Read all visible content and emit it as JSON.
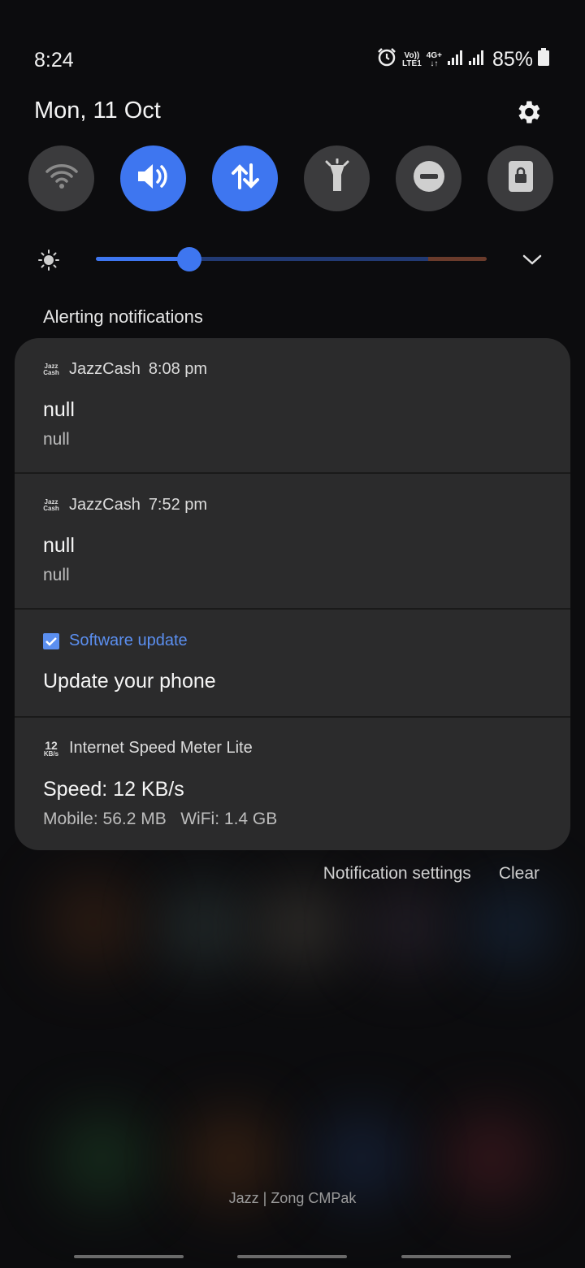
{
  "status_bar": {
    "time": "8:24",
    "volte_top": "Vo))",
    "volte_bottom": "LTE1",
    "net_top": "4G+",
    "net_bottom": "↓↑",
    "battery_percent": "85%",
    "icons": [
      "alarm-icon",
      "volte-icon",
      "4g-plus-icon",
      "signal-sim1-icon",
      "signal-sim2-icon",
      "battery-icon"
    ]
  },
  "header": {
    "date": "Mon, 11 Oct",
    "settings_icon": "gear-icon"
  },
  "quick_settings": [
    {
      "name": "wifi",
      "icon": "wifi-icon",
      "on": false
    },
    {
      "name": "sound",
      "icon": "volume-icon",
      "on": true
    },
    {
      "name": "mobile-data",
      "icon": "data-arrows-icon",
      "on": true
    },
    {
      "name": "flashlight",
      "icon": "flashlight-icon",
      "on": false
    },
    {
      "name": "do-not-disturb",
      "icon": "dnd-icon",
      "on": false
    },
    {
      "name": "portrait-lock",
      "icon": "rotation-lock-icon",
      "on": false
    }
  ],
  "brightness": {
    "level": 0.24,
    "icon": "sun-icon",
    "expand_icon": "chevron-down-icon"
  },
  "section_label": "Alerting notifications",
  "notifications": [
    {
      "app_icon_text_top": "Jazz",
      "app_icon_text_bottom": "Cash",
      "app": "JazzCash",
      "time": "8:08 pm",
      "title": "null",
      "body": "null"
    },
    {
      "app_icon_text_top": "Jazz",
      "app_icon_text_bottom": "Cash",
      "app": "JazzCash",
      "time": "7:52 pm",
      "title": "null",
      "body": "null"
    },
    {
      "app": "Software update",
      "title": "Update your phone"
    },
    {
      "app_icon_text_top": "12",
      "app_icon_text_bottom": "KB/s",
      "app": "Internet Speed Meter Lite",
      "title": "Speed: 12 KB/s",
      "body": "Mobile: 56.2 MB   WiFi: 1.4 GB"
    }
  ],
  "actions": {
    "settings_label": "Notification settings",
    "clear_label": "Clear"
  },
  "carrier_text": "Jazz | Zong CMPak",
  "colors": {
    "accent": "#3e76f0",
    "panel": "#2b2b2c",
    "tile_off": "#3b3b3d",
    "link": "#5b8ff0"
  }
}
